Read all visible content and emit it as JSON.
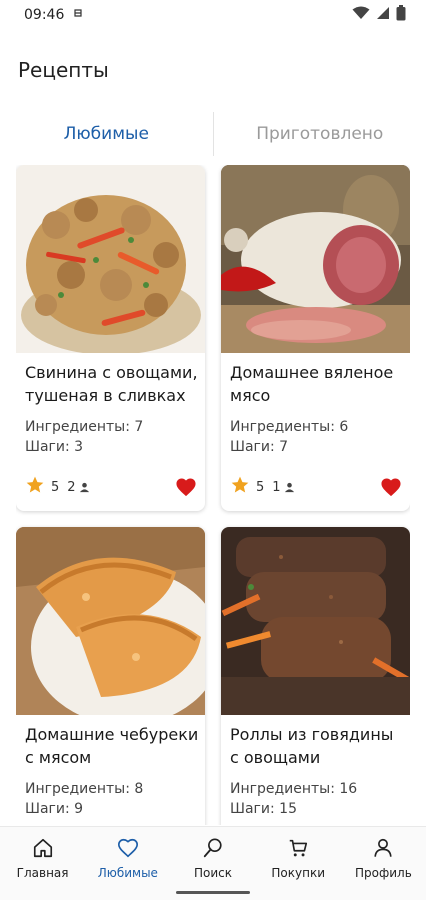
{
  "status_bar": {
    "time": "09:46"
  },
  "header": {
    "title": "Рецепты"
  },
  "tabs": [
    {
      "label": "Любимые",
      "active": true
    },
    {
      "label": "Приготовлено",
      "active": false
    }
  ],
  "recipes": [
    {
      "name": "Свинина с овощами, тушеная в сливках",
      "ingredients": "Ингредиенты: 7",
      "steps": "Шаги: 3",
      "rating": "5",
      "cooked_count": "2",
      "favorite": true
    },
    {
      "name": "Домашнее вяленое мясо",
      "ingredients": "Ингредиенты: 6",
      "steps": "Шаги: 7",
      "rating": "5",
      "cooked_count": "1",
      "favorite": true
    },
    {
      "name": "Домашние чебуреки с мясом",
      "ingredients": "Ингредиенты: 8",
      "steps": "Шаги: 9",
      "rating": "",
      "cooked_count": "",
      "favorite": true
    },
    {
      "name": "Роллы из говядины с овощами",
      "ingredients": "Ингредиенты: 16",
      "steps": "Шаги: 15",
      "rating": "",
      "cooked_count": "",
      "favorite": true
    }
  ],
  "bottom_nav": [
    {
      "label": "Главная",
      "icon": "home-icon",
      "active": false
    },
    {
      "label": "Любимые",
      "icon": "heart-outline-icon",
      "active": true
    },
    {
      "label": "Поиск",
      "icon": "search-icon",
      "active": false
    },
    {
      "label": "Покупки",
      "icon": "cart-icon",
      "active": false
    },
    {
      "label": "Профиль",
      "icon": "person-icon",
      "active": false
    }
  ],
  "colors": {
    "accent": "#1d5ea8",
    "star": "#f0a21f",
    "heart": "#d81b1b",
    "inactive_tab": "#9a9a9a"
  }
}
